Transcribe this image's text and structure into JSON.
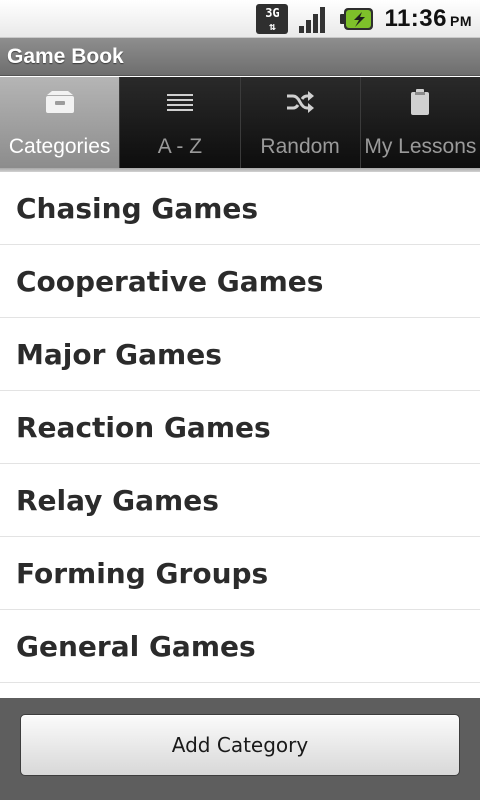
{
  "status_bar": {
    "network": "3G",
    "time": "11:36",
    "ampm": "PM"
  },
  "title_bar": {
    "title": "Game Book"
  },
  "tabs": [
    {
      "label": "Categories",
      "icon": "tray-icon",
      "active": true
    },
    {
      "label": "A - Z",
      "icon": "list-lines-icon",
      "active": false
    },
    {
      "label": "Random",
      "icon": "shuffle-icon",
      "active": false
    },
    {
      "label": "My Lessons",
      "icon": "clipboard-icon",
      "active": false
    }
  ],
  "categories": [
    {
      "label": "Chasing Games"
    },
    {
      "label": "Cooperative Games"
    },
    {
      "label": "Major Games"
    },
    {
      "label": "Reaction Games"
    },
    {
      "label": "Relay Games"
    },
    {
      "label": "Forming Groups"
    },
    {
      "label": "General Games"
    }
  ],
  "bottom_bar": {
    "add_button_label": "Add Category"
  },
  "colors": {
    "battery_green": "#7ec02a",
    "active_tab": "#a0a0a0",
    "tab_bg": "#1b1b1b",
    "title_bar": "#7e7e7e"
  }
}
